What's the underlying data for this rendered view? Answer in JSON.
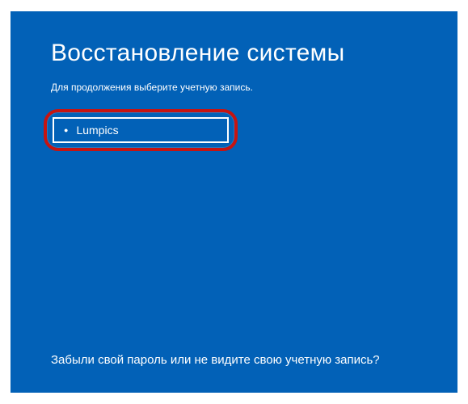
{
  "title": "Восстановление системы",
  "subtitle": "Для продолжения выберите учетную запись.",
  "accounts": [
    {
      "name": "Lumpics"
    }
  ],
  "footer_link": "Забыли свой пароль или не видите свою учетную запись?",
  "colors": {
    "background": "#0261b7",
    "highlight": "#c61411",
    "text": "#ffffff"
  }
}
